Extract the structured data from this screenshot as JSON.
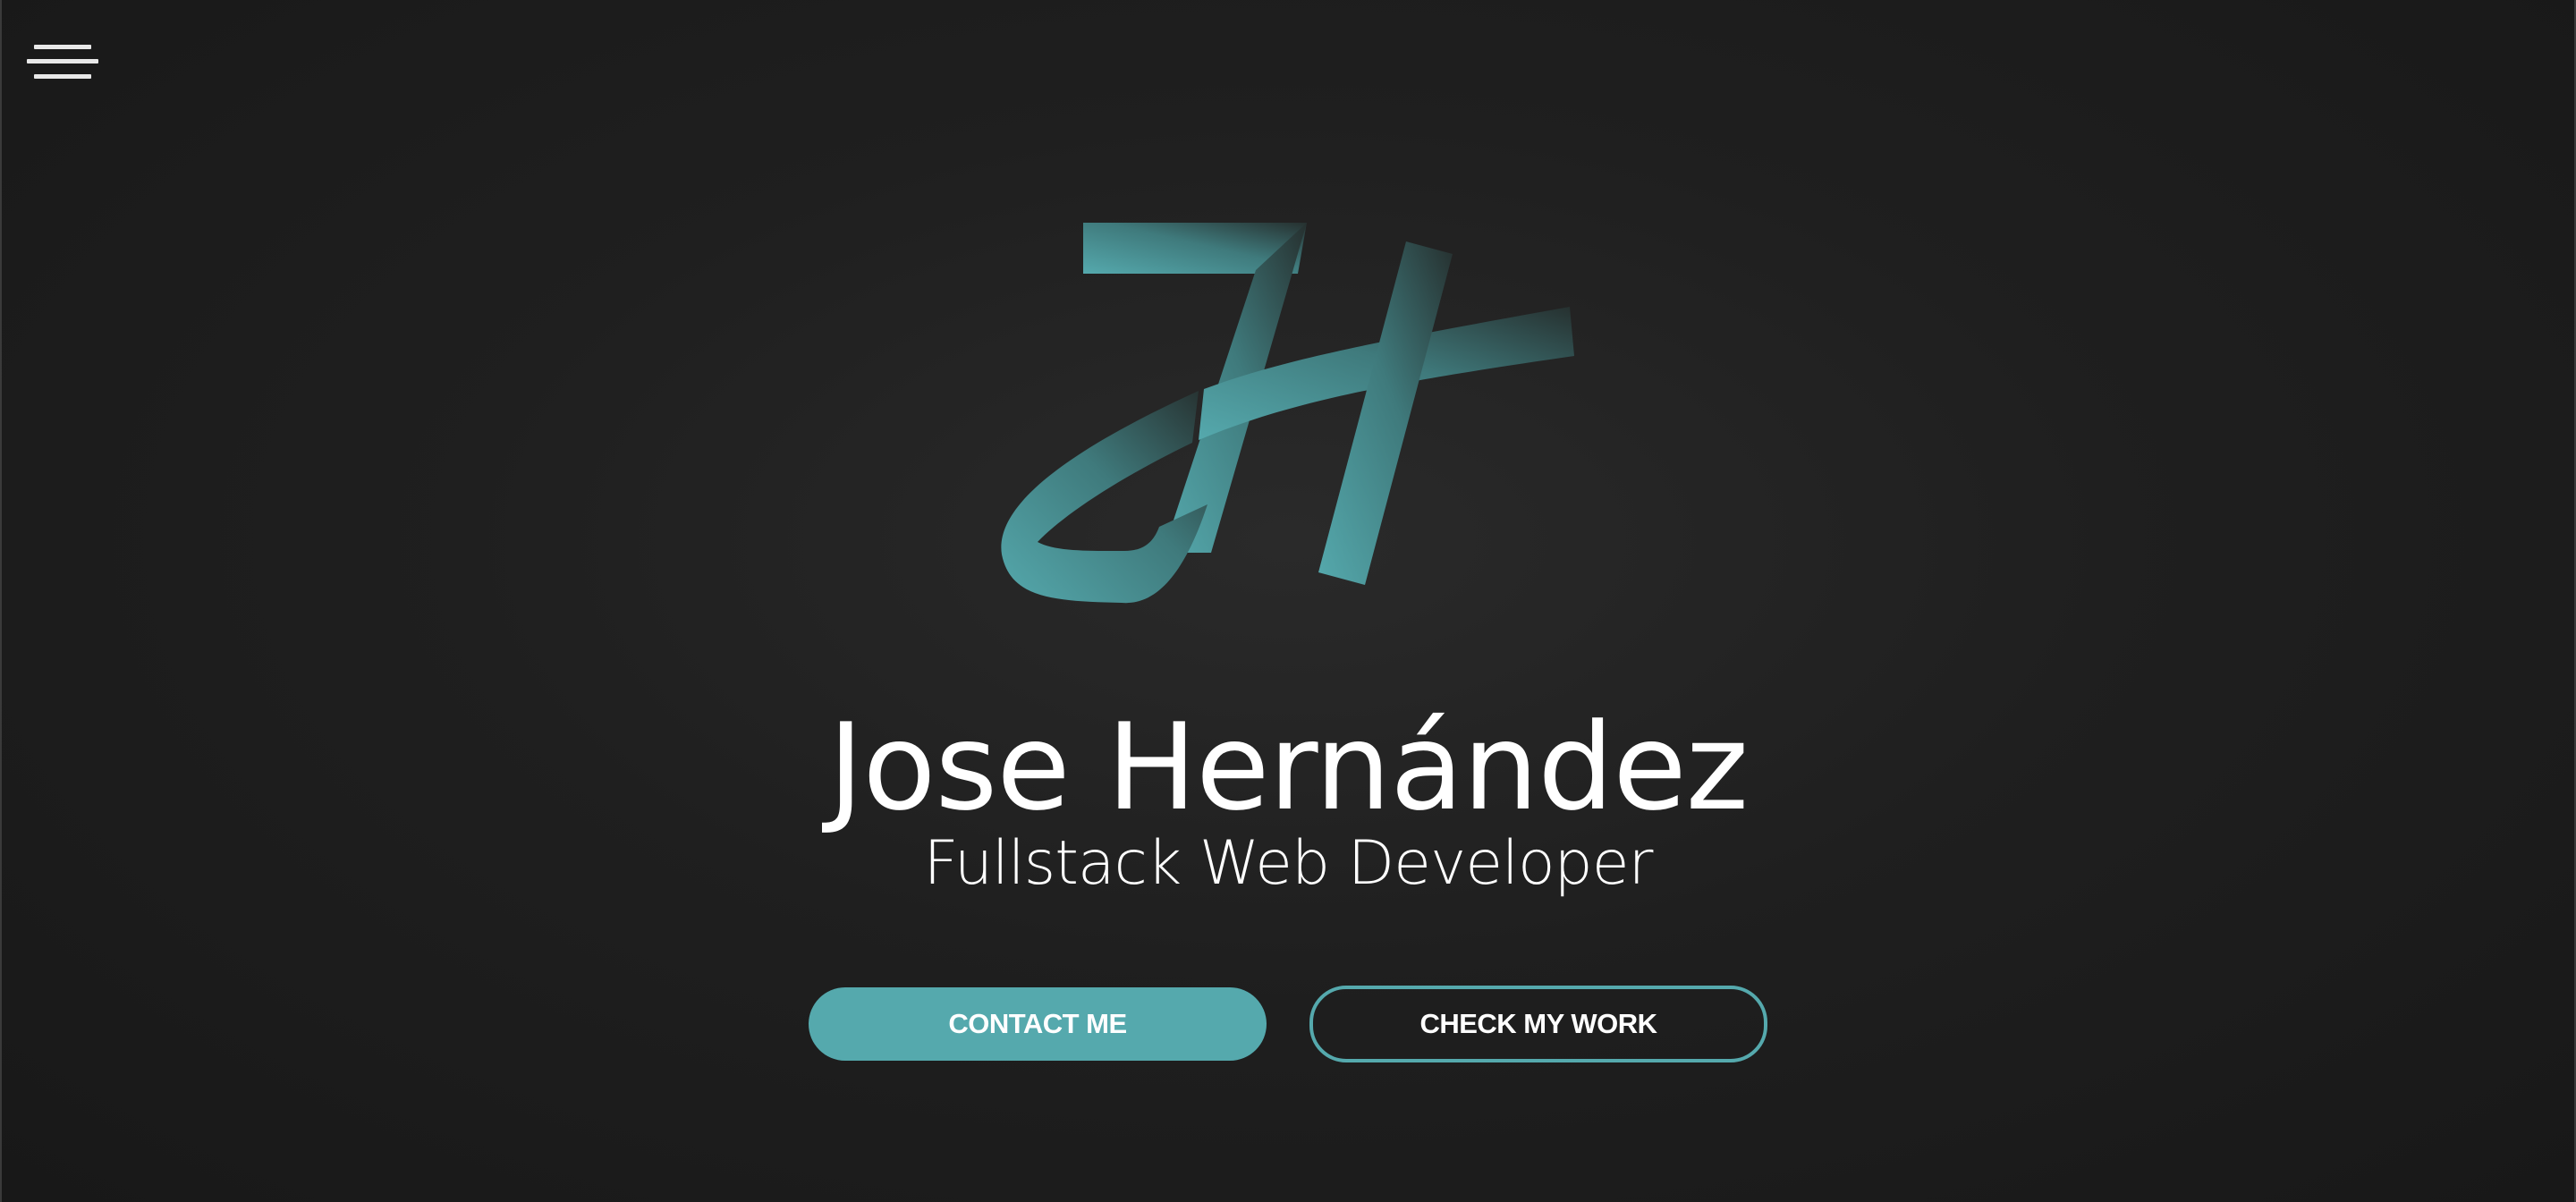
{
  "nav": {
    "menu_icon": "hamburger-menu-icon"
  },
  "logo": {
    "icon": "jh-monogram-logo",
    "colors": {
      "gradient_start": "#4e9ea0",
      "gradient_end": "#2a3a3b"
    }
  },
  "hero": {
    "name": "Jose Hernández",
    "title": "Fullstack Web Developer"
  },
  "actions": {
    "contact_label": "CONTACT ME",
    "work_label": "CHECK MY WORK"
  },
  "colors": {
    "accent": "#55a9ad",
    "background": "#1f1f1f",
    "text": "#ffffff"
  }
}
